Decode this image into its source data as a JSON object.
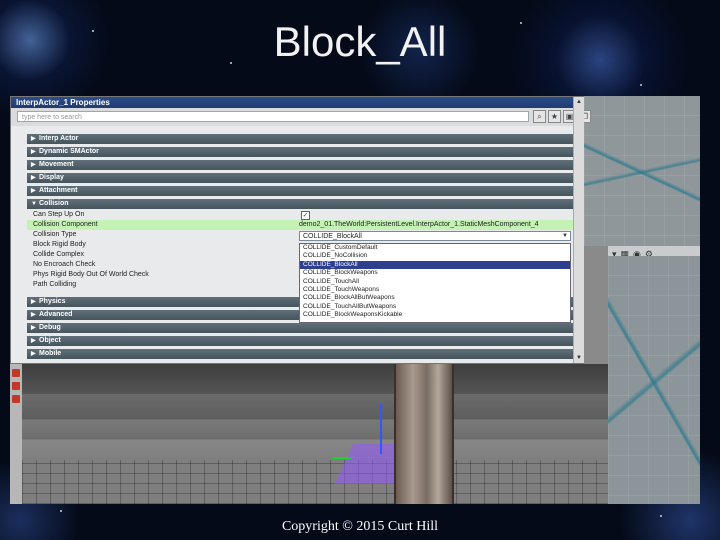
{
  "slide": {
    "title": "Block_All",
    "copyright": "Copyright © 2015 Curt Hill"
  },
  "colors": {
    "background": "#050c1c",
    "title_bar": "#1f3b6f",
    "category_bar": "#46545c",
    "highlight_row": "#c4f1b4",
    "selected_item": "#2d3f8e"
  },
  "window": {
    "title": "InterpActor_1 Properties",
    "search_placeholder": "type here to search",
    "search_buttons": [
      "search-icon",
      "star-icon",
      "lock-icon",
      "copy-icon"
    ]
  },
  "categories_top": [
    {
      "label": "Interp Actor"
    },
    {
      "label": "Dynamic SMActor"
    },
    {
      "label": "Movement"
    },
    {
      "label": "Display"
    },
    {
      "label": "Attachment"
    }
  ],
  "collision": {
    "label": "Collision",
    "rows": [
      {
        "label": "Can Step Up On",
        "checked": true
      },
      {
        "label": "Collision Component",
        "value": "demo2_01.TheWorld:PersistentLevel.InterpActor_1.StaticMeshComponent_4"
      },
      {
        "label": "Collision Type",
        "value": "COLLIDE_BlockAll"
      },
      {
        "label": "Block Rigid Body"
      },
      {
        "label": "Collide Complex"
      },
      {
        "label": "No Encroach Check"
      },
      {
        "label": "Phys Rigid Body Out Of World Check"
      },
      {
        "label": "Path Colliding"
      }
    ]
  },
  "collision_type_options": [
    {
      "label": "COLLIDE_CustomDefault",
      "selected": false
    },
    {
      "label": "COLLIDE_NoCollision",
      "selected": false
    },
    {
      "label": "COLLIDE_BlockAll",
      "selected": true
    },
    {
      "label": "COLLIDE_BlockWeapons",
      "selected": false
    },
    {
      "label": "COLLIDE_TouchAll",
      "selected": false
    },
    {
      "label": "COLLIDE_TouchWeapons",
      "selected": false
    },
    {
      "label": "COLLIDE_BlockAllButWeapons",
      "selected": false
    },
    {
      "label": "COLLIDE_TouchAllButWeapons",
      "selected": false
    },
    {
      "label": "COLLIDE_BlockWeaponsKickable",
      "selected": false
    }
  ],
  "categories_bottom": [
    {
      "label": "Physics"
    },
    {
      "label": "Advanced"
    },
    {
      "label": "Debug"
    },
    {
      "label": "Object"
    },
    {
      "label": "Mobile"
    }
  ]
}
